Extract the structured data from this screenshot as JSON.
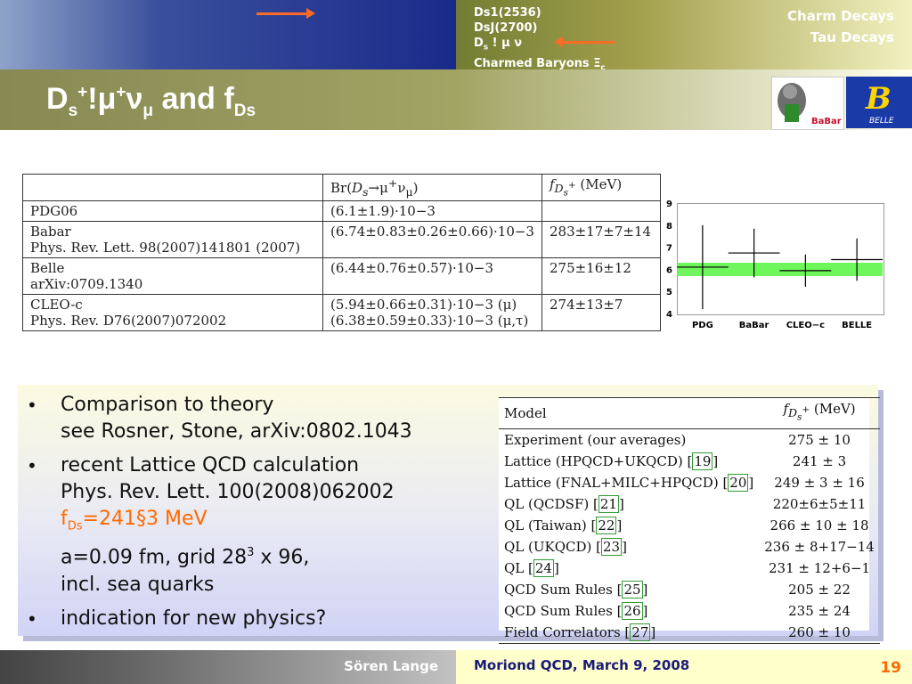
{
  "nav": {
    "left": [
      "Charm Decays",
      "Tau Decays"
    ],
    "right": [
      "Ds1(2536)",
      "DsJ(2700)",
      "Ds ! μ ν",
      "Charmed Baryons Ξc"
    ]
  },
  "title": {
    "base": "D",
    "s_sub": "s",
    "plus1": "+",
    "bang": "!",
    "mu": "μ",
    "plus2": "+",
    "nu": "ν",
    "mu_sub": "μ",
    "and_text": " and f",
    "ds_sub": "Ds"
  },
  "logos": {
    "babar_text": "BaBar",
    "belle_text": "BELLE"
  },
  "measurements_table": {
    "header": [
      "",
      "Br(Ds→μ+νμ)",
      "fDs+ (MeV)"
    ],
    "rows": [
      {
        "source": [
          "PDG06"
        ],
        "br": [
          "(6.1±1.9)·10−3"
        ],
        "f": [
          ""
        ]
      },
      {
        "source": [
          "Babar",
          "Phys. Rev. Lett. 98(2007)141801 (2007)"
        ],
        "br": [
          "(6.74±0.83±0.26±0.66)·10−3"
        ],
        "f": [
          "283±17±7±14"
        ]
      },
      {
        "source": [
          "Belle",
          "arXiv:0709.1340"
        ],
        "br": [
          "(6.44±0.76±0.57)·10−3"
        ],
        "f": [
          "275±16±12"
        ]
      },
      {
        "source": [
          "CLEO-c",
          "Phys. Rev. D76(2007)072002"
        ],
        "br": [
          "(5.94±0.66±0.31)·10−3 (μ)",
          "(6.38±0.59±0.33)·10−3 (μ,τ)"
        ],
        "f": [
          "274±13±7"
        ]
      }
    ]
  },
  "chart_data": {
    "type": "scatter",
    "categories": [
      "PDG",
      "BaBar",
      "CLEO−c",
      "BELLE"
    ],
    "values": [
      6.1,
      6.74,
      5.94,
      6.44
    ],
    "errors": [
      1.9,
      1.1,
      0.73,
      0.96
    ],
    "band": [
      5.7,
      6.3
    ],
    "ylim": [
      4,
      9
    ],
    "yticks": [
      4,
      5,
      6,
      7,
      8,
      9
    ]
  },
  "bullets": [
    {
      "lines": [
        "Comparison to theory",
        "see Rosner, Stone, arXiv:0802.1043"
      ]
    },
    {
      "lines": [
        "recent Lattice QCD calculation",
        "Phys. Rev. Lett. 100(2008)062002"
      ],
      "highlight_pre": "f",
      "highlight_sub": "Ds",
      "highlight_post": "=241§3 MeV",
      "extra_pre": "a=0.09 fm, grid 28",
      "extra_sup": "3",
      "extra_post": " x 96,",
      "extra_last": "incl. sea quarks"
    },
    {
      "lines": [
        "indication for new physics?"
      ]
    }
  ],
  "model_table": {
    "header": [
      "Model",
      "fDs+ (MeV)"
    ],
    "rows": [
      {
        "model": "Experiment (our averages)",
        "ref": "",
        "value": "275 ± 10"
      },
      {
        "model": "Lattice (HPQCD+UKQCD) ",
        "ref": "19",
        "value": "241 ± 3"
      },
      {
        "model": "Lattice (FNAL+MILC+HPQCD) ",
        "ref": "20",
        "value": "249 ± 3 ± 16"
      },
      {
        "model": "QL (QCDSF) ",
        "ref": "21",
        "value": "220±6±5±11"
      },
      {
        "model": "QL (Taiwan) ",
        "ref": "22",
        "value": "266 ± 10 ± 18"
      },
      {
        "model": "QL (UKQCD) ",
        "ref": "23",
        "value": "236 ± 8+17−14"
      },
      {
        "model": "QL ",
        "ref": "24",
        "value": "231 ± 12+6−1"
      },
      {
        "model": "QCD Sum Rules ",
        "ref": "25",
        "value": "205 ± 22"
      },
      {
        "model": "QCD Sum Rules ",
        "ref": "26",
        "value": "235 ± 24"
      },
      {
        "model": "Field Correlators ",
        "ref": "27",
        "value": "260 ± 10"
      }
    ]
  },
  "footer": {
    "author": "Sören Lange",
    "conference": "Moriond QCD, March 9, 2008",
    "page": "19"
  },
  "colors": {
    "accent_orange": "#ff6a00",
    "band_green": "#5ef54a",
    "header_blue": "#1a2a8a"
  }
}
